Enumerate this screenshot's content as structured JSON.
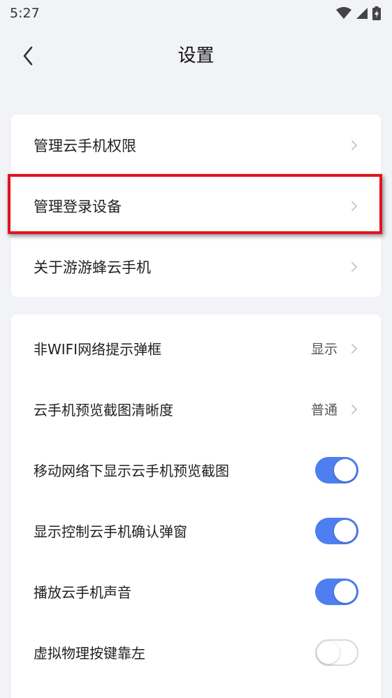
{
  "status_bar": {
    "time": "5:27"
  },
  "header": {
    "title": "设置"
  },
  "group1": {
    "items": [
      {
        "label": "管理云手机权限"
      },
      {
        "label": "管理登录设备"
      },
      {
        "label": "关于游游蜂云手机"
      }
    ]
  },
  "group2": {
    "items": [
      {
        "label": "非WIFI网络提示弹框",
        "value": "显示"
      },
      {
        "label": "云手机预览截图清晰度",
        "value": "普通"
      },
      {
        "label": "移动网络下显示云手机预览截图",
        "toggle": true
      },
      {
        "label": "显示控制云手机确认弹窗",
        "toggle": true
      },
      {
        "label": "播放云手机声音",
        "toggle": true
      },
      {
        "label": "虚拟物理按键靠左",
        "toggle": false
      }
    ]
  },
  "colors": {
    "accent": "#4e7ef0",
    "highlight": "#e2141f",
    "background": "#f2f3f7"
  }
}
